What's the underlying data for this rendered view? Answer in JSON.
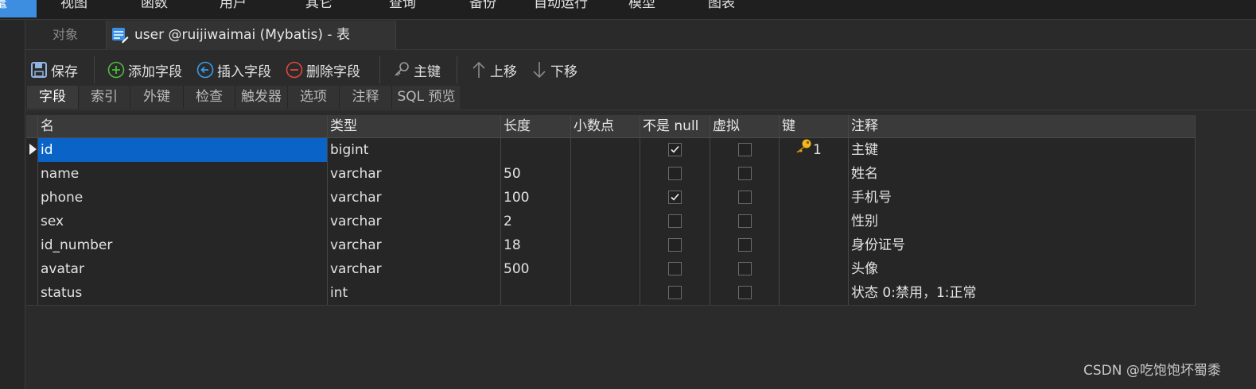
{
  "menu": {
    "items": [
      "视图",
      "函数",
      "用户",
      "其它",
      "查询",
      "备份",
      "自动运行",
      "模型",
      "图表"
    ],
    "partial_left": "鼍"
  },
  "tabs": {
    "objects_label": "对象",
    "table_label": "user @ruijiwaimai (Mybatis) - 表"
  },
  "toolbar": {
    "save": "保存",
    "add_field": "添加字段",
    "insert_field": "插入字段",
    "delete_field": "删除字段",
    "primary_key": "主键",
    "move_up": "上移",
    "move_down": "下移"
  },
  "subtabs": [
    "字段",
    "索引",
    "外键",
    "检查",
    "触发器",
    "选项",
    "注释",
    "SQL 预览"
  ],
  "grid": {
    "columns": [
      "名",
      "类型",
      "长度",
      "小数点",
      "不是 null",
      "虚拟",
      "键",
      "注释"
    ],
    "rows": [
      {
        "name": "id",
        "type": "bigint",
        "length": "",
        "decimal": "",
        "not_null": true,
        "virtual": false,
        "key": "1",
        "comment": "主键"
      },
      {
        "name": "name",
        "type": "varchar",
        "length": "50",
        "decimal": "",
        "not_null": false,
        "virtual": false,
        "key": "",
        "comment": "姓名"
      },
      {
        "name": "phone",
        "type": "varchar",
        "length": "100",
        "decimal": "",
        "not_null": true,
        "virtual": false,
        "key": "",
        "comment": "手机号"
      },
      {
        "name": "sex",
        "type": "varchar",
        "length": "2",
        "decimal": "",
        "not_null": false,
        "virtual": false,
        "key": "",
        "comment": "性别"
      },
      {
        "name": "id_number",
        "type": "varchar",
        "length": "18",
        "decimal": "",
        "not_null": false,
        "virtual": false,
        "key": "",
        "comment": "身份证号"
      },
      {
        "name": "avatar",
        "type": "varchar",
        "length": "500",
        "decimal": "",
        "not_null": false,
        "virtual": false,
        "key": "",
        "comment": "头像"
      },
      {
        "name": "status",
        "type": "int",
        "length": "",
        "decimal": "",
        "not_null": false,
        "virtual": false,
        "key": "",
        "comment": "状态 0:禁用，1:正常"
      }
    ]
  },
  "watermark": "CSDN @吃饱饱坏蜀黍"
}
